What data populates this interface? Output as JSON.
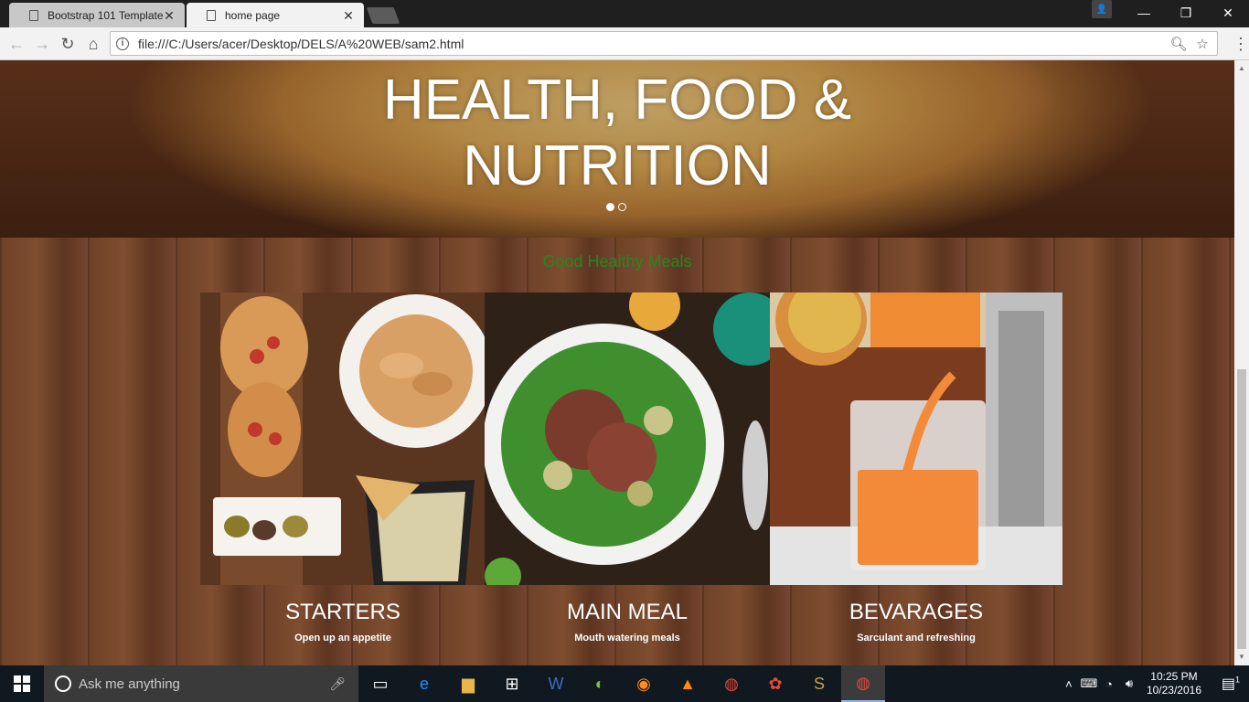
{
  "browser": {
    "tabs": [
      {
        "title": "Bootstrap 101 Template",
        "active": false
      },
      {
        "title": "home page",
        "active": true
      }
    ],
    "url": "file:///C:/Users/acer/Desktop/DELS/A%20WEB/sam2.html"
  },
  "page": {
    "hero": {
      "line1": "HEALTH, FOOD &",
      "line2": "NUTRITION",
      "slide_count": 2,
      "active_slide": 1
    },
    "section_title": "Good Healthy Meals",
    "cards": [
      {
        "title": "STARTERS",
        "subtitle": "Open up an appetite"
      },
      {
        "title": "MAIN MEAL",
        "subtitle": "Mouth watering meals"
      },
      {
        "title": "BEVARAGES",
        "subtitle": "Sarculant and refreshing"
      }
    ]
  },
  "taskbar": {
    "search_placeholder": "Ask me anything",
    "time": "10:25 PM",
    "date": "10/23/2016",
    "notification_count": "1"
  },
  "colors": {
    "section_title": "#1f8a1f",
    "taskbar_bg": "#101820"
  }
}
